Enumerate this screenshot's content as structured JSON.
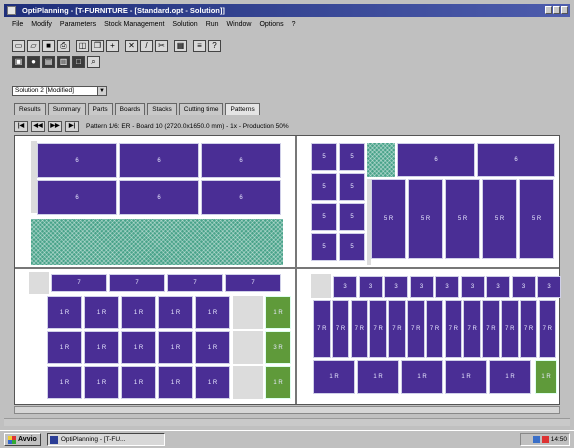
{
  "window": {
    "title": "OptiPlanning - [T-FURNITURE - [Standard.opt - Solution]]"
  },
  "menu": [
    "File",
    "Modify",
    "Parameters",
    "Stock Management",
    "Solution",
    "Run",
    "Window",
    "Options",
    "?"
  ],
  "toolbar": {
    "row1": [
      "new-doc-icon",
      "open-icon",
      "save-icon",
      "print-icon",
      "preview-icon",
      "copy-icon",
      "add-icon",
      "delete-icon",
      "edit-icon",
      "cut-icon",
      "calc-icon",
      "grid-icon",
      "help-icon"
    ],
    "row2": [
      "stock-icon",
      "run-icon",
      "report-icon",
      "chart-icon",
      "window-icon",
      "zoom-icon"
    ]
  },
  "solution_select": {
    "value": "Solution 2 [Modified]"
  },
  "tabs": [
    {
      "label": "Results",
      "active": false
    },
    {
      "label": "Summary",
      "active": false
    },
    {
      "label": "Parts",
      "active": false
    },
    {
      "label": "Boards",
      "active": false
    },
    {
      "label": "Stacks",
      "active": false
    },
    {
      "label": "Cutting time",
      "active": false
    },
    {
      "label": "Patterns",
      "active": true
    }
  ],
  "nav": {
    "first": "|◀",
    "prev": "◀◀",
    "next": "▶▶",
    "last": "▶|",
    "info": "Pattern 1/6: ER - Board 10 (2720.0x1650.0 mm) - 1x - Production 50%"
  },
  "colors": {
    "piece": "#4a2e95",
    "waste": "#49a38a",
    "green": "#5f9a3a"
  },
  "patterns": {
    "p1": {
      "labels": [
        "6",
        "6",
        "6",
        "6",
        "6",
        "6"
      ]
    },
    "p2": {
      "small": [
        "5",
        "5",
        "5",
        "5",
        "5",
        "5",
        "5",
        "5"
      ],
      "top": [
        "6",
        "6"
      ],
      "tall": [
        "5 R",
        "5 R",
        "5 R",
        "5 R",
        "5 R"
      ]
    },
    "p3": {
      "top": [
        "7",
        "7",
        "7",
        "7"
      ],
      "grid": [
        "1 R",
        "1 R",
        "1 R",
        "1 R",
        "1 R",
        "1 R",
        "1 R",
        "1 R",
        "1 R",
        "1 R",
        "1 R",
        "1 R",
        "1 R",
        "1 R",
        "1 R"
      ],
      "green": [
        "1 R",
        "3 R",
        "1 R"
      ]
    },
    "p4": {
      "top": [
        "3",
        "3",
        "3",
        "3",
        "3",
        "3",
        "3",
        "3",
        "3"
      ],
      "mid": [
        "7 R",
        "7 R",
        "7 R",
        "7 R",
        "7 R",
        "7 R",
        "7 R",
        "7 R",
        "7 R",
        "7 R",
        "7 R",
        "7 R",
        "7 R"
      ],
      "bottom": [
        "1 R",
        "1 R",
        "1 R",
        "1 R",
        "1 R"
      ],
      "green": "1 R"
    }
  },
  "taskbar": {
    "start": "Avvio",
    "task": "OptiPlanning - [T-FU...",
    "clock": "14:50"
  }
}
